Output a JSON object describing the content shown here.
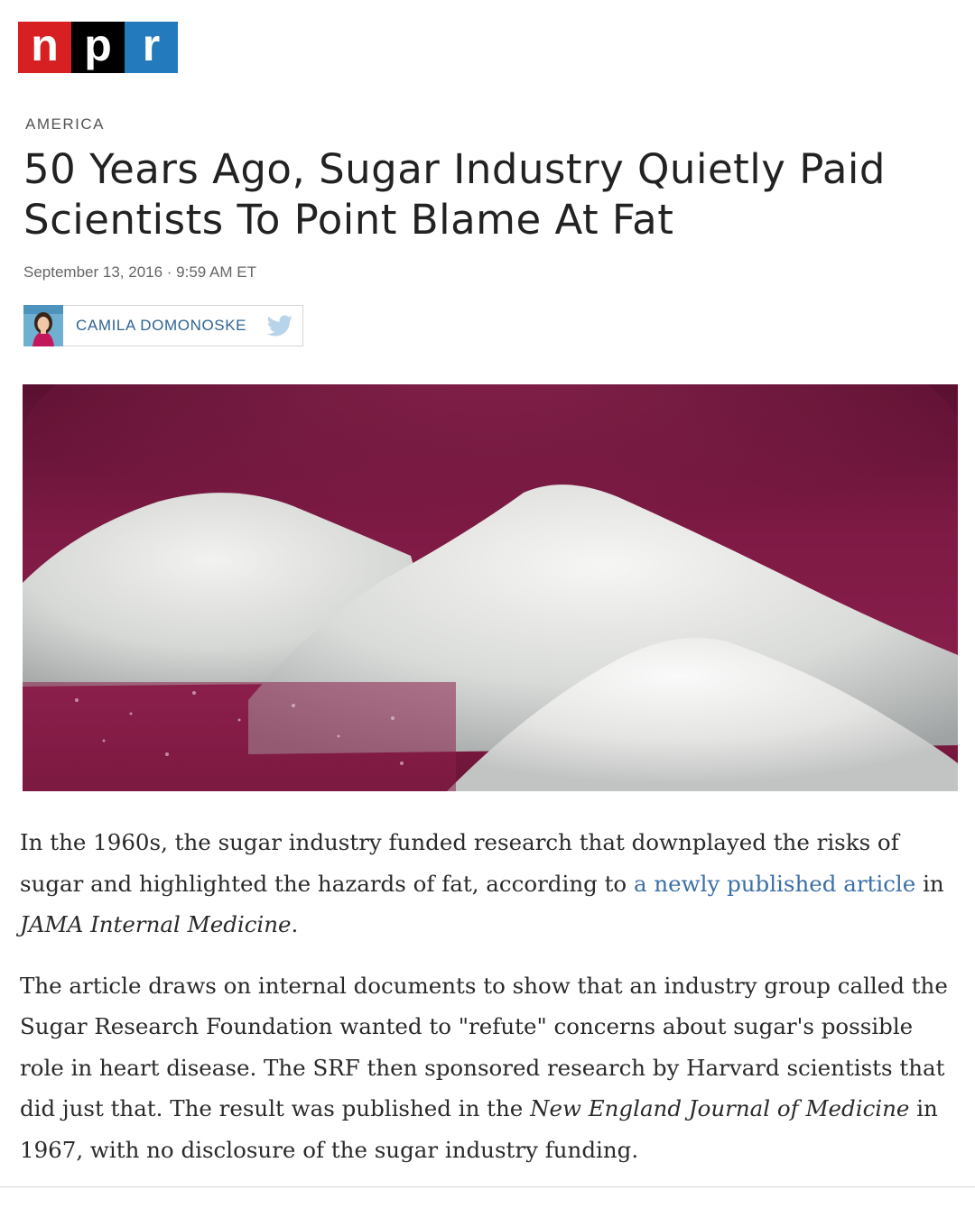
{
  "logo": {
    "letters": [
      "n",
      "p",
      "r"
    ],
    "colors": [
      "#d62021",
      "#000000",
      "#237bbd"
    ]
  },
  "article": {
    "section": "AMERICA",
    "headline": "50 Years Ago, Sugar Industry Quietly Paid Scientists To Point Blame At Fat",
    "dateline": "September 13, 2016 · 9:59 AM ET",
    "author": "CAMILA DOMONOSKE",
    "author_icon": "twitter-icon",
    "paragraphs": [
      {
        "text_before_link": "In the 1960s, the sugar industry funded research that downplayed the risks of sugar and highlighted the hazards of fat, according to ",
        "link_text": "a newly published article",
        "text_after_link": " in ",
        "italic": "JAMA Internal Medicine",
        "end": "."
      },
      {
        "text_before_italic": "The article draws on internal documents to show that an industry group called the Sugar Research Foundation wanted to \"refute\" concerns about sugar's possible role in heart disease. The SRF then sponsored research by Harvard scientists that did just that. The result was published in the ",
        "italic": "New England Journal of Medicine",
        "text_after_italic": " in 1967, with no disclosure of the sugar industry funding."
      }
    ]
  },
  "colors": {
    "link": "#3a6fa8",
    "byline_name": "#2f6493",
    "hero_background": "#7a1840"
  }
}
